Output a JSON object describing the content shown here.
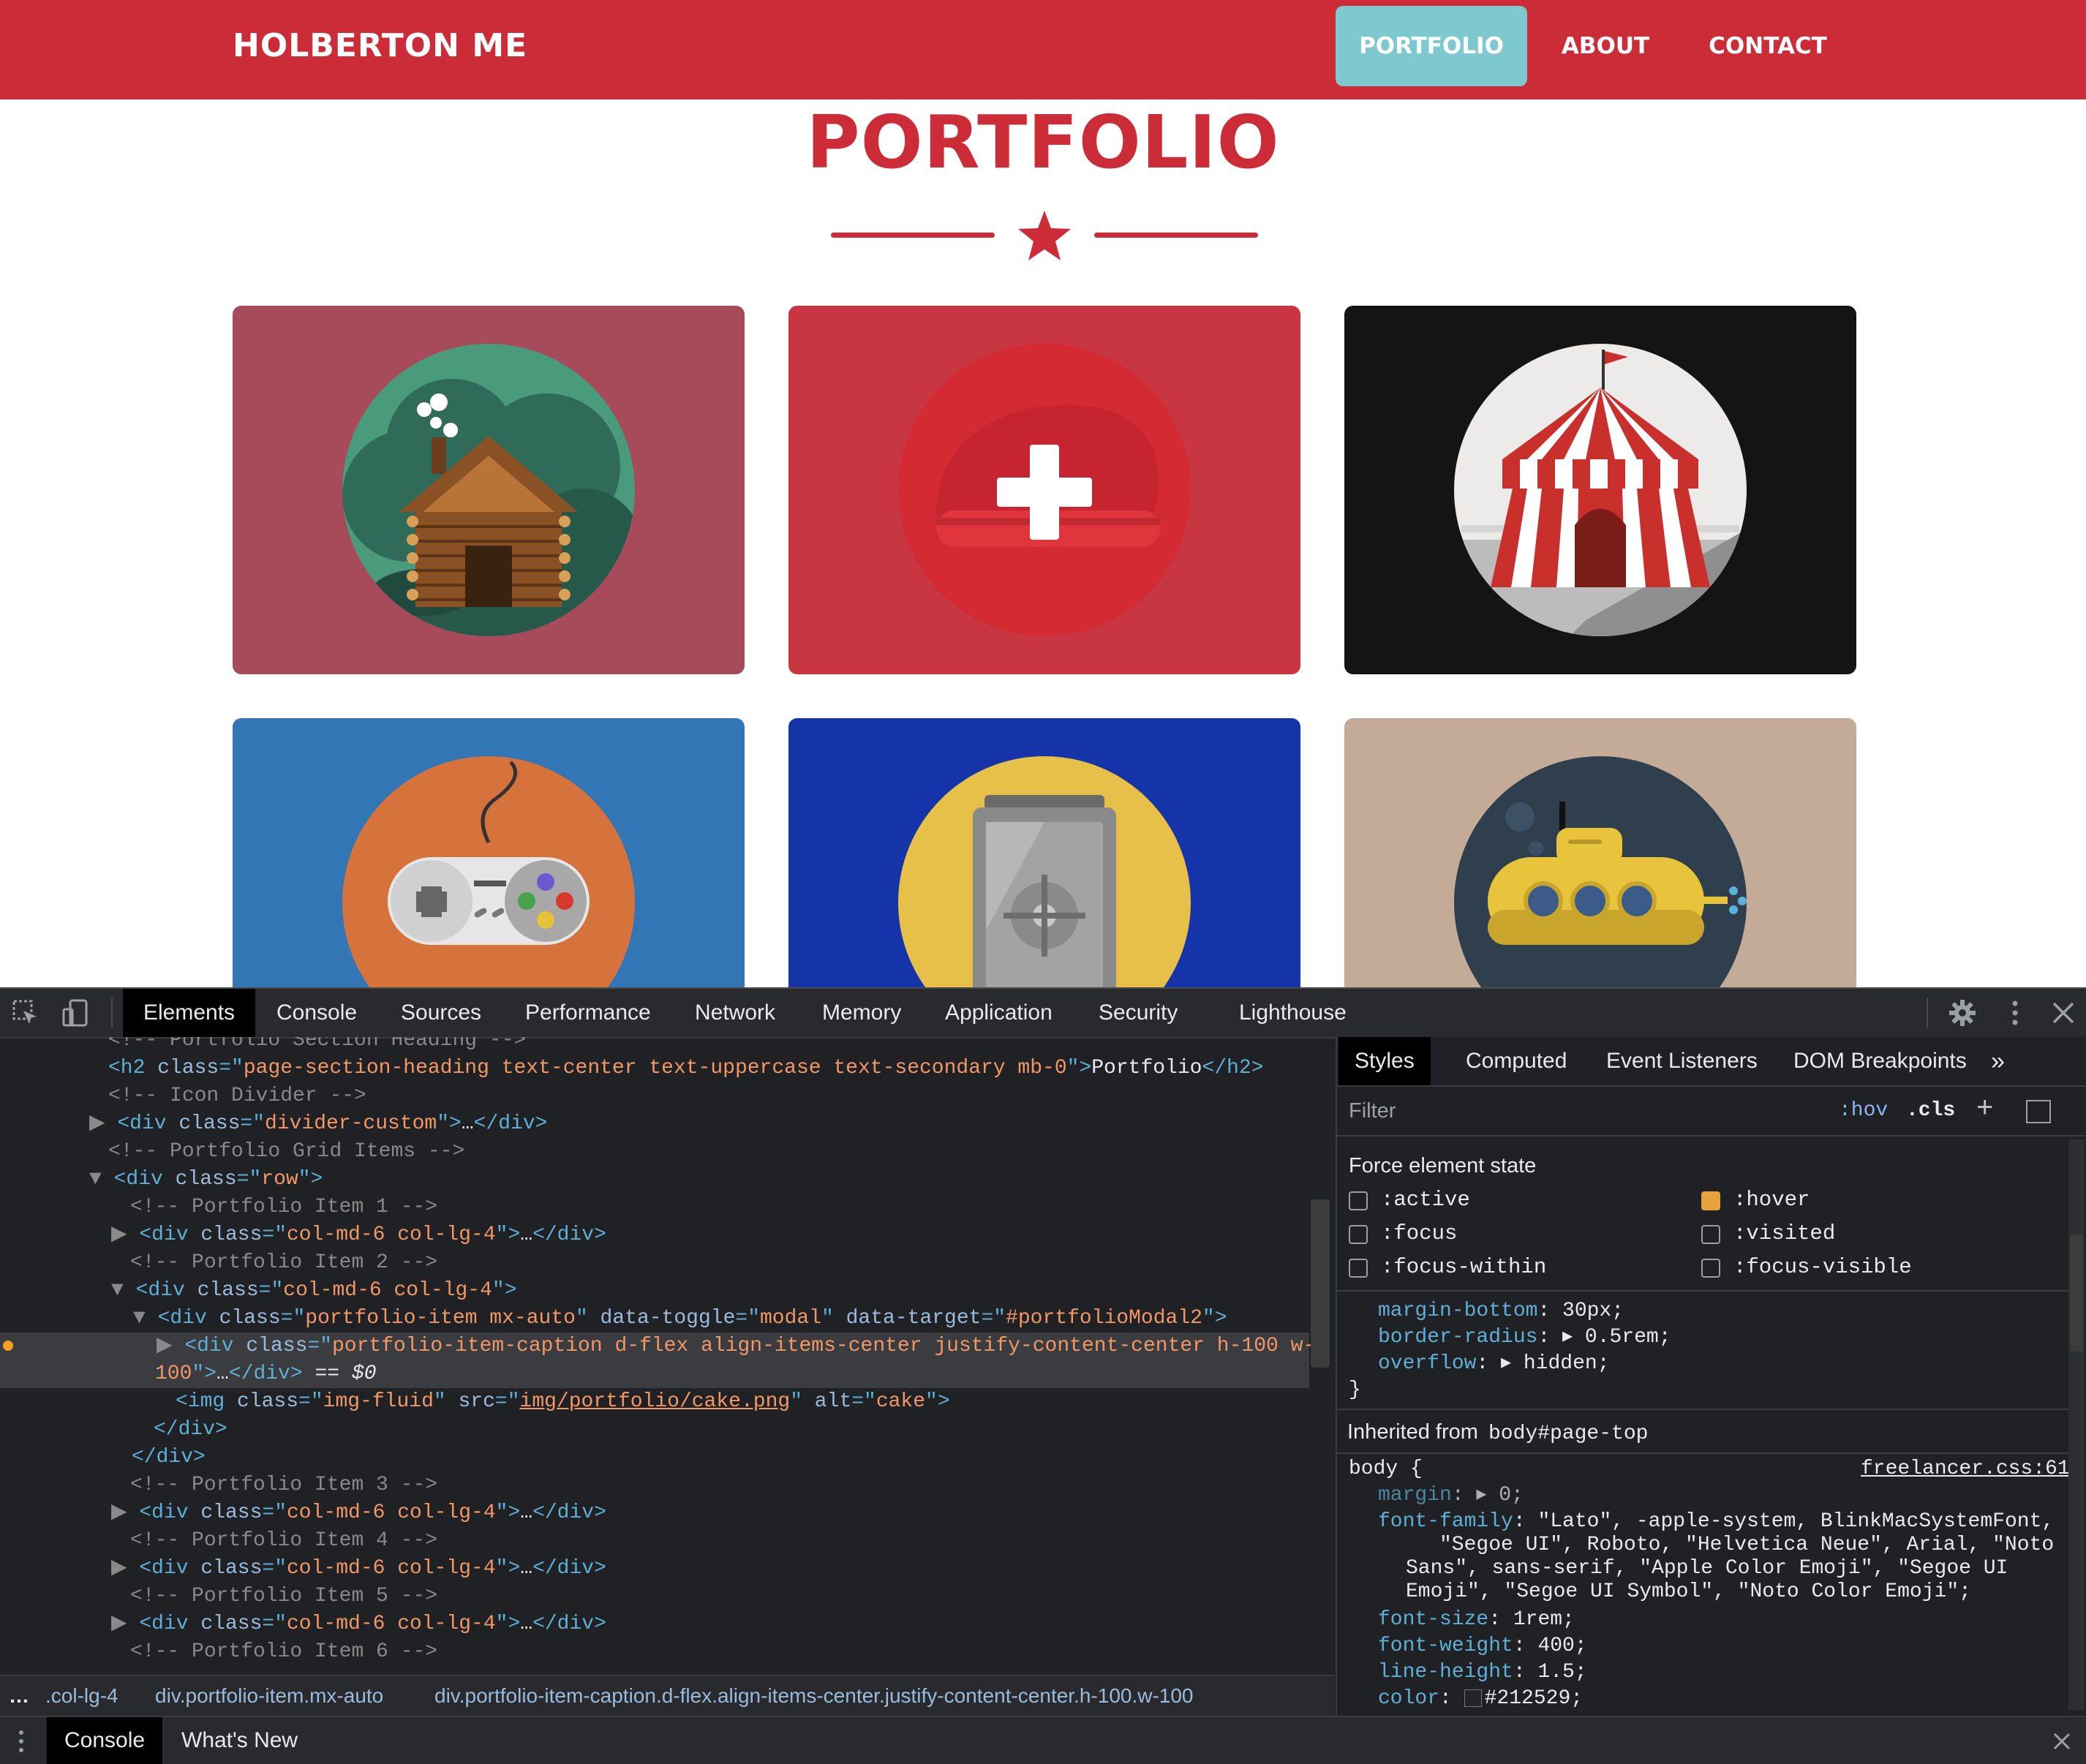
{
  "site": {
    "brand": "HOLBERTON ME",
    "nav": [
      "PORTFOLIO",
      "ABOUT",
      "CONTACT"
    ],
    "section_title": "PORTFOLIO"
  },
  "portfolio_items": [
    {
      "name": "cabin",
      "bg": "#a74b5a"
    },
    {
      "name": "cake",
      "bg": "#c73641"
    },
    {
      "name": "circus",
      "bg": "#141414"
    },
    {
      "name": "game",
      "bg": "#3276b6"
    },
    {
      "name": "safe",
      "bg": "#1634a9"
    },
    {
      "name": "submarine",
      "bg": "#c4ab98"
    }
  ],
  "colors": {
    "brand_red": "#cc2c38",
    "nav_active": "#7ec8cf"
  },
  "devtools": {
    "tabs": [
      "Elements",
      "Console",
      "Sources",
      "Performance",
      "Network",
      "Memory",
      "Application",
      "Security",
      "Lighthouse"
    ],
    "elements": {
      "partial_line": "<!-- Portfolio Section Heading -->",
      "lines": [
        {
          "t": "<h2 class=\"page-section-heading text-center text-uppercase text-secondary mb-0\">Portfolio</h2>"
        },
        {
          "t": "<!-- Icon Divider -->"
        },
        {
          "t": "<div class=\"divider-custom\">…</div>"
        },
        {
          "t": "<!-- Portfolio Grid Items -->"
        },
        {
          "t": "<div class=\"row\">"
        },
        {
          "t": "<!-- Portfolio Item 1 -->"
        },
        {
          "t": "<div class=\"col-md-6 col-lg-4\">…</div>"
        },
        {
          "t": "<!-- Portfolio Item 2 -->"
        },
        {
          "t": "<div class=\"col-md-6 col-lg-4\">"
        },
        {
          "t": "<div class=\"portfolio-item mx-auto\" data-toggle=\"modal\" data-target=\"#portfolioModal2\">"
        },
        {
          "t": "<div class=\"portfolio-item-caption d-flex align-items-center justify-content-center h-100 w-"
        },
        {
          "t": "100\">…</div> == $0"
        },
        {
          "t": "<img class=\"img-fluid\" src=\"img/portfolio/cake.png\" alt=\"cake\">"
        },
        {
          "t": "</div>"
        },
        {
          "t": "</div>"
        },
        {
          "t": "<!-- Portfolio Item 3 -->"
        },
        {
          "t": "<div class=\"col-md-6 col-lg-4\">…</div>"
        },
        {
          "t": "<!-- Portfolio Item 4 -->"
        },
        {
          "t": "<div class=\"col-md-6 col-lg-4\">…</div>"
        },
        {
          "t": "<!-- Portfolio Item 5 -->"
        },
        {
          "t": "<div class=\"col-md-6 col-lg-4\">…</div>"
        },
        {
          "t": "<!-- Portfolio Item 6 -->"
        }
      ]
    },
    "breadcrumbs": [
      "…",
      ".col-lg-4",
      "div.portfolio-item.mx-auto",
      "div.portfolio-item-caption.d-flex.align-items-center.justify-content-center.h-100.w-100"
    ],
    "styles_tabs": [
      "Styles",
      "Computed",
      "Event Listeners",
      "DOM Breakpoints"
    ],
    "filter_placeholder": "Filter",
    "hov_label": ":hov",
    "cls_label": ".cls",
    "force_state": {
      "title": "Force element state",
      "states": [
        {
          "label": ":active",
          "checked": false
        },
        {
          "label": ":hover",
          "checked": true
        },
        {
          "label": ":focus",
          "checked": false
        },
        {
          "label": ":visited",
          "checked": false
        },
        {
          "label": ":focus-within",
          "checked": false
        },
        {
          "label": ":focus-visible",
          "checked": false
        }
      ]
    },
    "rule_partial": [
      {
        "prop": "margin-bottom",
        "val": "30px;"
      },
      {
        "prop": "border-radius",
        "val": "0.5rem;"
      },
      {
        "prop": "overflow",
        "val": "hidden;"
      }
    ],
    "inherited_label": "Inherited from",
    "inherited_selector": "body#page-top",
    "body_rule": {
      "selector": "body {",
      "source": "freelancer.css:61",
      "margin": "0;",
      "font_family_1": "\"Lato\", -apple-system, BlinkMacSystemFont,",
      "font_family_2": "\"Segoe UI\", Roboto, \"Helvetica Neue\", Arial, \"Noto",
      "font_family_3": "Sans\", sans-serif, \"Apple Color Emoji\", \"Segoe UI",
      "font_family_4": "Emoji\", \"Segoe UI Symbol\", \"Noto Color Emoji\";",
      "font_size": "1rem;",
      "font_weight": "400;",
      "line_height": "1.5;",
      "color": "#212529;"
    },
    "drawer_tabs": [
      "Console",
      "What's New"
    ]
  }
}
